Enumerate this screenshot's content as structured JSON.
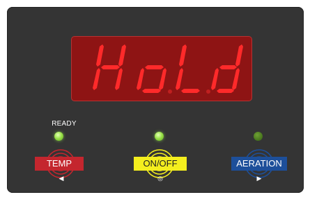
{
  "display": {
    "text": "HoLd"
  },
  "ready_label": "READY",
  "buttons": [
    {
      "id": "temp",
      "label": "TEMP",
      "glyph": "◀",
      "led_state": "on"
    },
    {
      "id": "onoff",
      "label": "ON/OFF",
      "glyph": "◎",
      "led_state": "on"
    },
    {
      "id": "aeration",
      "label": "AERATION",
      "glyph": "▶",
      "led_state": "off"
    }
  ],
  "colors": {
    "panel": "#343434",
    "display_bg": "#8e1414",
    "segment_on": "#ff2a2a",
    "temp": "#c4262e",
    "onoff": "#f4ee1e",
    "aeration": "#1d4f9a"
  }
}
